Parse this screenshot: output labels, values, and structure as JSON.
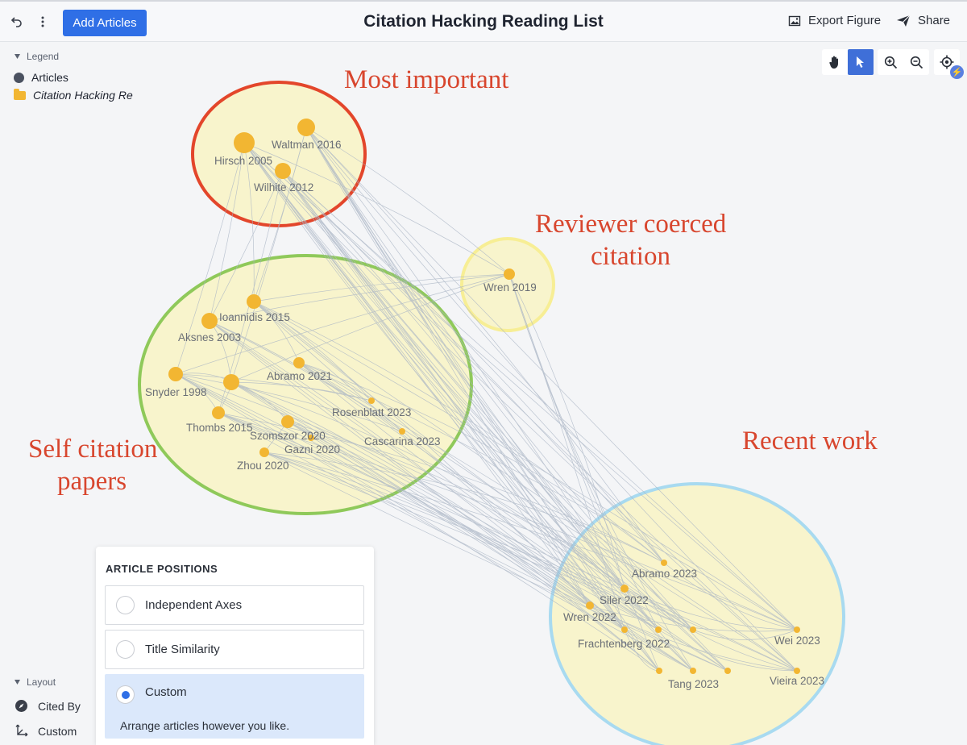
{
  "toolbar": {
    "title": "Citation Hacking Reading List",
    "add_articles_label": "Add Articles",
    "export_label": "Export Figure",
    "share_label": "Share"
  },
  "legend": {
    "heading": "Legend",
    "items": [
      {
        "label": "Articles",
        "icon": "circle-icon"
      },
      {
        "label": "Citation Hacking Re",
        "icon": "folder-icon",
        "color": "#f2b632"
      }
    ]
  },
  "canvas_tools": [
    "hand-icon",
    "pointer-icon",
    "zoom-in-icon",
    "zoom-out-icon",
    "locate-icon"
  ],
  "annotations": {
    "most_important": "Most important",
    "reviewer_line1": "Reviewer coerced",
    "reviewer_line2": "citation",
    "self_line1": "Self citation",
    "self_line2": "papers",
    "recent": "Recent work"
  },
  "clusters": {
    "most_important": {
      "color": "#e3462b"
    },
    "self_citation": {
      "color": "#8fc95a"
    },
    "reviewer": {
      "color": "#f7ee95"
    },
    "recent": {
      "color": "#a8daf0"
    }
  },
  "nodes": [
    {
      "label": "Hirsch 2005"
    },
    {
      "label": "Waltman 2016"
    },
    {
      "label": "Wilhite 2012"
    },
    {
      "label": "Wren 2019"
    },
    {
      "label": "Ioannidis 2015"
    },
    {
      "label": "Aksnes 2003"
    },
    {
      "label": "Abramo 2021"
    },
    {
      "label": "Snyder 1998"
    },
    {
      "label": "Rosenblatt 2023"
    },
    {
      "label": "Thombs 2015"
    },
    {
      "label": "Cascarina 2023"
    },
    {
      "label": "Szomszor 2020"
    },
    {
      "label": "Gazni 2020"
    },
    {
      "label": "Zhou 2020"
    },
    {
      "label": "Abramo 2023"
    },
    {
      "label": "Siler 2022"
    },
    {
      "label": "Wren 2022"
    },
    {
      "label": "Frachtenberg 2022"
    },
    {
      "label": "Wei 2023"
    },
    {
      "label": "Tang 2023"
    },
    {
      "label": "Vieira 2023"
    }
  ],
  "layout": {
    "heading": "Layout",
    "items": [
      {
        "label": "Cited By",
        "icon": "compass-icon"
      },
      {
        "label": "Custom",
        "icon": "move-icon"
      }
    ]
  },
  "positions_panel": {
    "title": "ARTICLE POSITIONS",
    "options": [
      {
        "label": "Independent Axes",
        "selected": false
      },
      {
        "label": "Title Similarity",
        "selected": false
      },
      {
        "label": "Custom",
        "selected": true,
        "description": "Arrange articles however you like."
      }
    ]
  }
}
